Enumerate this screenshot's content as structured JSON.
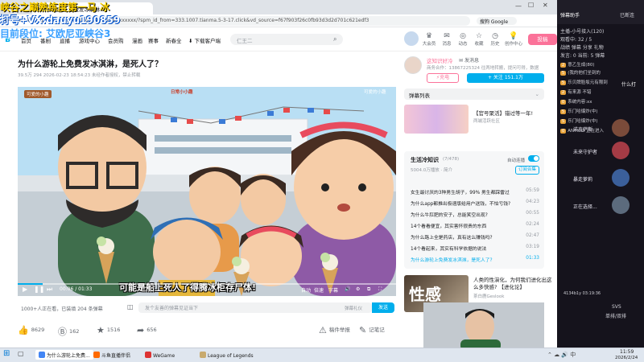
{
  "overlay": {
    "line1": "峡谷之巅熟练度第一马 冰",
    "line2": "打号+VX:dauyu190859",
    "line3": "目前段位: 艾欧尼亚峡谷3"
  },
  "browser": {
    "tab_title": "为什么游轮上免费发冰淇淋...",
    "url": "ww.bilibili.com/video/BV1xxxxxx/?spm_id_from=333.1007.tianma.5-3-17.click&vd_source=f67f903f26c0fb93d3d2d701c621edf3",
    "search_engine": "搜狗 Google"
  },
  "site_header": {
    "nav": [
      "首页",
      "番剧",
      "直播",
      "游戏中心",
      "会员购",
      "漫画",
      "赛事",
      "新春全",
      "下载客户端"
    ],
    "search_placeholder": "仁王二",
    "icons": [
      {
        "icon": "crown-icon",
        "label": "大会员"
      },
      {
        "icon": "message-icon",
        "label": "消息"
      },
      {
        "icon": "dynamic-icon",
        "label": "动态"
      },
      {
        "icon": "star-icon",
        "label": "收藏"
      },
      {
        "icon": "history-icon",
        "label": "历史"
      },
      {
        "icon": "creator-icon",
        "label": "创作中心"
      }
    ],
    "upload_label": "投稿"
  },
  "video": {
    "title": "为什么游轮上免费发冰淇淋，是死人了？",
    "meta": "39.5万   294   2026-02-23 18:54:23   未经作者授权，禁止转载",
    "scene_sign_left": "可爱的小趣",
    "scene_sign_center": "日常小小趣",
    "scene_sign_right": "可爱的小趣",
    "subtitle": "可能是船上死人了得腾冰柜存尸体!",
    "time_current": "00:06",
    "time_total": "01:33",
    "progress": 0.065,
    "ctrl_right": [
      "自动",
      "倍速",
      "字幕"
    ],
    "viewers": "1000+人正在看，已装填 204 条弹幕",
    "danmu_placeholder": "发个友善的弹幕见证当下",
    "danmu_etiquette": "弹幕礼仪",
    "danmu_send": "发送"
  },
  "actions": [
    {
      "icon": "like-icon",
      "glyph": "👍",
      "label": "8629"
    },
    {
      "icon": "coin-icon",
      "glyph": "Ⓑ",
      "label": "162"
    },
    {
      "icon": "favorite-icon",
      "glyph": "★",
      "label": "1516"
    },
    {
      "icon": "share-icon",
      "glyph": "➦",
      "label": "656"
    },
    {
      "icon": "report-icon",
      "glyph": "⚠",
      "label": "稿件举报"
    },
    {
      "icon": "note-icon",
      "glyph": "✎",
      "label": "记笔记"
    }
  ],
  "uploader": {
    "name": "这知识好冷",
    "send_msg": "发消息",
    "desc": "商务合作：13867225324 往两地转搬，提问可得，数据",
    "charge": "充电",
    "follow": "+ 关注 151.1万"
  },
  "danmu_list": {
    "label": "弹幕列表"
  },
  "ad": {
    "title": "【官号聚活】错过等一年!",
    "sub": "两端活跃社区"
  },
  "collection": {
    "title": "生活冷知识",
    "count": "(7/478)",
    "autoplay": "自动连播",
    "meta": "5004.0万播放 · 简介",
    "subscribe": "订阅合集",
    "items": [
      {
        "title": "女生最讨厌的3种男生胡子，99% 男生都踩雷过",
        "duration": "05:59"
      },
      {
        "title": "为什么app都推出极速版给用户送钱，不怕亏钱?",
        "duration": "04:23"
      },
      {
        "title": "为什么牛肛肥的安子，总能笑空出现?",
        "duration": "00:55"
      },
      {
        "title": "14个看看便宜，其实害怀很贵的东西",
        "duration": "02:24"
      },
      {
        "title": "为什么路上全是药店，真有这么赚钱吗?",
        "duration": "02:47"
      },
      {
        "title": "14个看起来，其实有科学依据的说法",
        "duration": "03:19"
      },
      {
        "title": "为什么游轮上免费发冰淇淋，是死人了?",
        "duration": "01:33",
        "active": true
      }
    ]
  },
  "recommend": {
    "title": "人类的性演化，为何我们进化出这么多快感? 【进化论】",
    "up": "茶白鹿Geslook",
    "thumb_text": "性感"
  },
  "live_panel": {
    "header": "弹幕助手",
    "status": "已断连",
    "lines": [
      "主播-小号接入(120)",
      "观看中: 32 / 5",
      "战绩 弹幕 分享 礼物",
      "发言: 0 当前: 5 弹幕"
    ],
    "chat": [
      {
        "badge": "2",
        "text": "意乙生成(80)"
      },
      {
        "badge": "5",
        "text": "(我的他们坐到的"
      },
      {
        "badge": "5",
        "text": "乐贝牌脸坂元有限到"
      },
      {
        "badge": "2",
        "text": "有来源 不错"
      },
      {
        "badge": "0",
        "text": "系统内容:xx"
      },
      {
        "badge": "5",
        "text": "乐门哈爆炸(中)"
      },
      {
        "badge": "5",
        "text": "乐门哈爆炸(中)"
      },
      {
        "badge": "0",
        "text": "ANTICO 正在进入"
      }
    ],
    "side_label": "什么打",
    "champions": [
      {
        "name": "诺克萨斯",
        "color": "#7a4b3a"
      },
      {
        "name": "未来守护者",
        "color": "#a43b45"
      },
      {
        "name": "暴走萝莉",
        "color": "#3b5f9a"
      },
      {
        "name": "正在选择...",
        "color": "#5c6b7d"
      }
    ],
    "footer": [
      "4134b1y 03:19:36",
      "SVS",
      "单排/双排"
    ]
  },
  "taskbar": {
    "items": [
      {
        "label": "为什么游轮上免费...",
        "color": "#4285f4",
        "active": true
      },
      {
        "label": "斗鱼直播伴侣",
        "color": "#ff6a00"
      },
      {
        "label": "WeGame",
        "color": "#d33"
      },
      {
        "label": "League of Legends",
        "color": "#c8aa6e"
      }
    ],
    "time": "11:59",
    "date": "2026/2/24"
  }
}
